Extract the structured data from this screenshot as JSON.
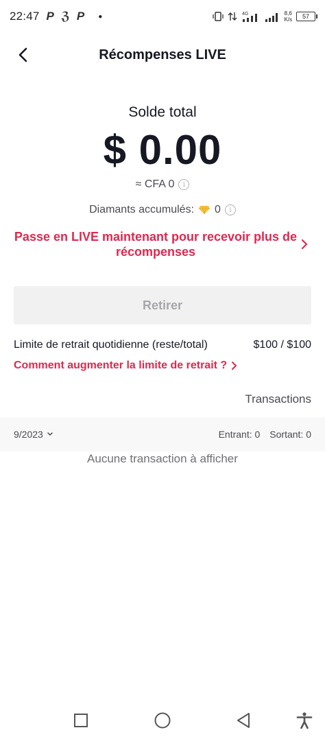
{
  "status_bar": {
    "time": "22:47",
    "net_speed_value": "8,6",
    "net_speed_unit": "K/s",
    "battery": "57",
    "network": "4G"
  },
  "header": {
    "title": "Récompenses LIVE"
  },
  "balance": {
    "label": "Solde total",
    "amount": "$ 0.00",
    "converted": "≈ CFA 0"
  },
  "diamonds": {
    "label": "Diamants accumulés:",
    "count": "0"
  },
  "promo": {
    "text": "Passe en LIVE maintenant pour recevoir plus de récompenses"
  },
  "withdraw": {
    "label": "Retirer"
  },
  "limit": {
    "label": "Limite de retrait quotidienne (reste/total)",
    "value": "$100 / $100",
    "help_link": "Comment augmenter la limite de retrait ?"
  },
  "transactions": {
    "link": "Transactions",
    "month": "9/2023",
    "incoming": "Entrant: 0",
    "outgoing": "Sortant: 0",
    "empty": "Aucune transaction à afficher"
  },
  "colors": {
    "accent": "#e0284e",
    "disabled_bg": "#f1f1f2",
    "disabled_text": "#a7a7ab",
    "diamond": "#f5c243"
  }
}
